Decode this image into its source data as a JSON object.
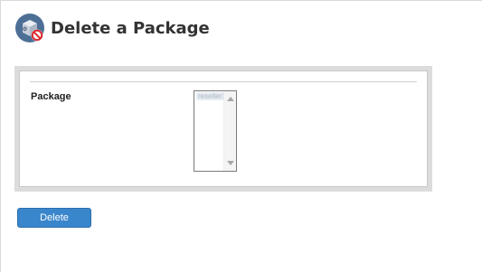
{
  "header": {
    "title": "Delete a Package",
    "icon": "package-delete-icon"
  },
  "form": {
    "package_label": "Package",
    "package_options": [
      "reseller1"
    ],
    "package_selected": "reseller1"
  },
  "actions": {
    "delete_label": "Delete",
    "delete_color": "#3a86cc"
  }
}
